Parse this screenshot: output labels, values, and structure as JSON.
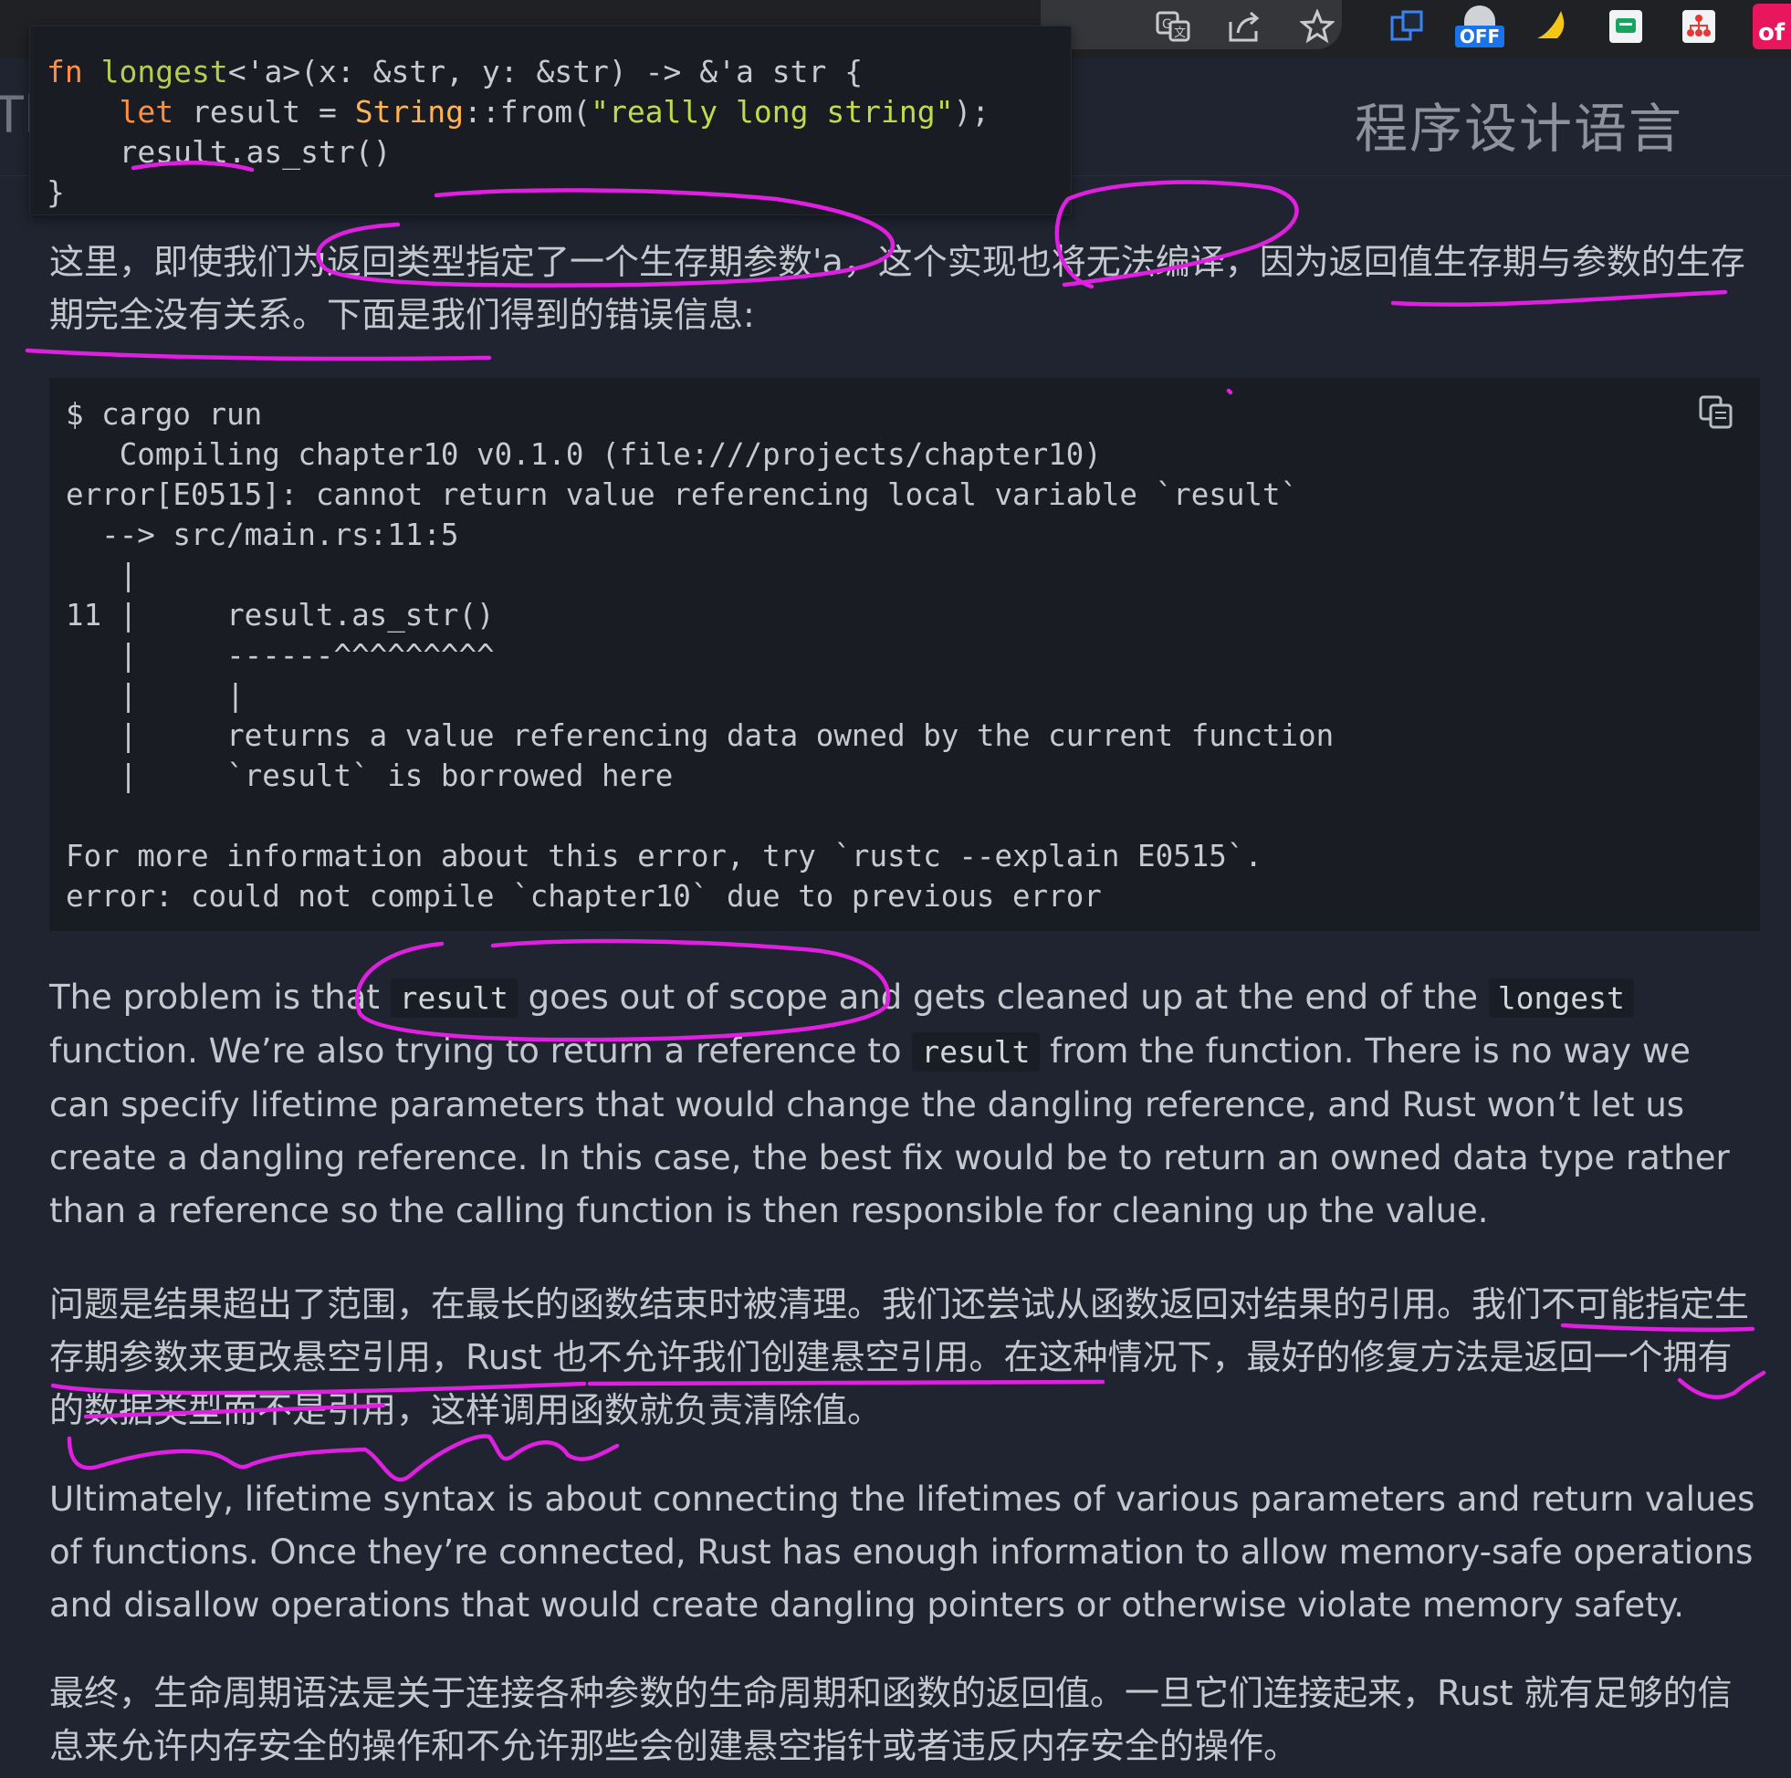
{
  "browser": {
    "toolbar_icons": [
      "translate-icon",
      "share-icon",
      "bookmark-star-icon"
    ],
    "extensions": [
      {
        "name": "extension-blue-icon"
      },
      {
        "name": "extension-off-badge",
        "badge": "OFF"
      },
      {
        "name": "extension-yellow-icon"
      },
      {
        "name": "extension-green-chat-icon"
      },
      {
        "name": "extension-red-network-icon"
      },
      {
        "name": "extension-red-partial",
        "label": "of"
      }
    ]
  },
  "header": {
    "left_title_fragment": "Th",
    "right_title": "程序设计语言"
  },
  "popup_code": {
    "line1": {
      "fn": "fn",
      "name": "longest",
      "sig": "<'a>(x: &str, y: &str) -> &'a str {"
    },
    "line2": {
      "let": "let",
      "rest1": " result = ",
      "type": "String",
      "rest2": "::from(",
      "str": "\"really long string\"",
      "rest3": ");"
    },
    "line3": "result.as_str()",
    "line4": "}"
  },
  "paragraphs": {
    "zh1": "这里，即使我们为返回类型指定了一个生存期参数'a，这个实现也将无法编译，因为返回值生存期与参数的生存期完全没有关系。下面是我们得到的错误信息:",
    "terminal": "$ cargo run\n   Compiling chapter10 v0.1.0 (file:///projects/chapter10)\nerror[E0515]: cannot return value referencing local variable `result`\n  --> src/main.rs:11:5\n   |\n11 |     result.as_str()\n   |     ------^^^^^^^^^\n   |     |\n   |     returns a value referencing data owned by the current function\n   |     `result` is borrowed here\n\nFor more information about this error, try `rustc --explain E0515`.\nerror: could not compile `chapter10` due to previous error",
    "en1_a": "The problem is that ",
    "en1_code1": "result",
    "en1_b": " goes out of scope and gets cleaned up at the end of the ",
    "en1_code2": "longest",
    "en1_c": " function. We’re also trying to return a reference to ",
    "en1_code3": "result",
    "en1_d": " from the function. There is no way we can specify lifetime parameters that would change the dangling reference, and Rust won’t let us create a dangling reference. In this case, the best fix would be to return an owned data type rather than a reference so the calling function is then responsible for cleaning up the value.",
    "zh2": "问题是结果超出了范围，在最长的函数结束时被清理。我们还尝试从函数返回对结果的引用。我们不可能指定生存期参数来更改悬空引用，Rust 也不允许我们创建悬空引用。在这种情况下，最好的修复方法是返回一个拥有的数据类型而不是引用，这样调用函数就负责清除值。",
    "en2": "Ultimately, lifetime syntax is about connecting the lifetimes of various parameters and return values of functions. Once they’re connected, Rust has enough information to allow memory-safe operations and disallow operations that would create dangling pointers or otherwise violate memory safety.",
    "zh3": "最终，生命周期语法是关于连接各种参数的生命周期和函数的返回值。一旦它们连接起来，Rust 就有足够的信息来允许内存安全的操作和不允许那些会创建悬空指针或者违反内存安全的操作。"
  },
  "colors": {
    "background": "#1f2430",
    "code_bg": "#191c22",
    "annotation": "#e020e0"
  }
}
